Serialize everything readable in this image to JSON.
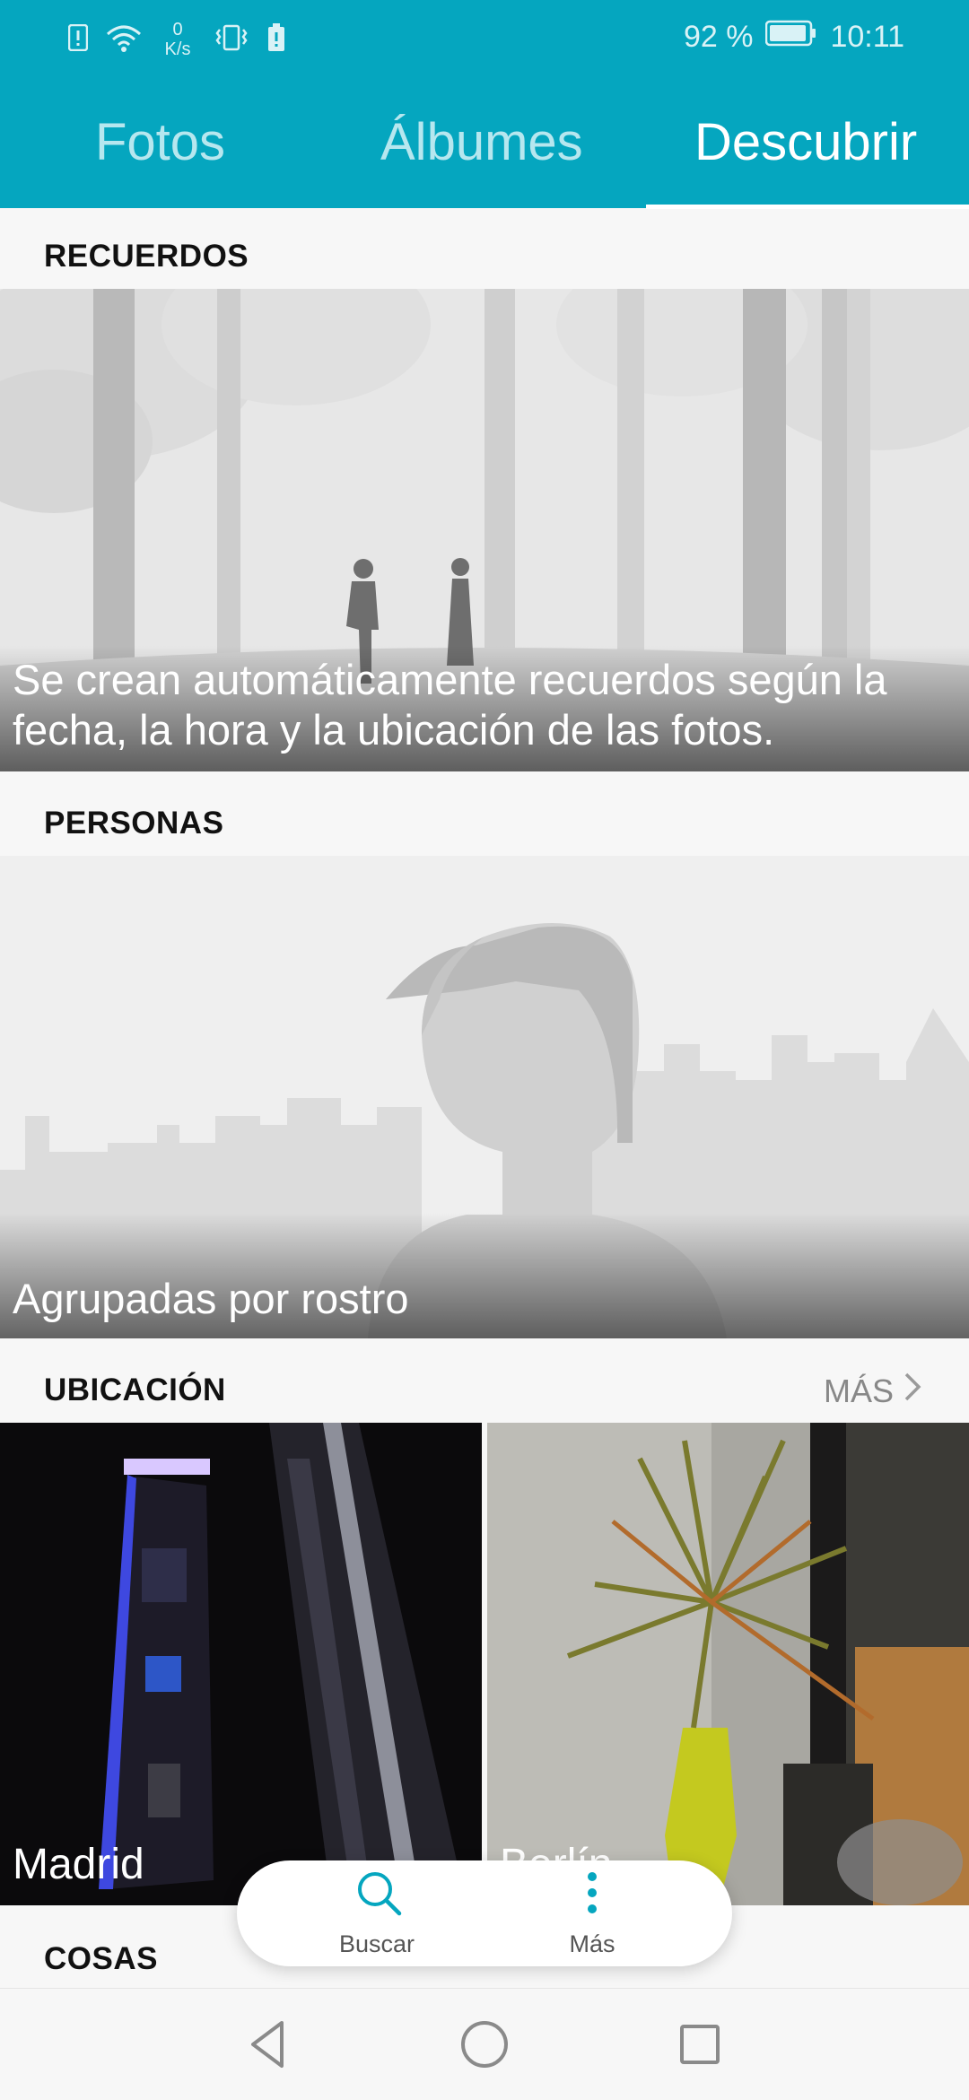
{
  "status_bar": {
    "net_speed_value": "0",
    "net_speed_unit": "K/s",
    "battery_percent": "92 %",
    "time": "10:11"
  },
  "tabs": [
    {
      "label": "Fotos",
      "active": false
    },
    {
      "label": "Álbumes",
      "active": false
    },
    {
      "label": "Descubrir",
      "active": true
    }
  ],
  "sections": {
    "memories": {
      "title": "RECUERDOS",
      "caption": "Se crean automáticamente recuerdos según la fecha, la hora y la ubicación de las fotos."
    },
    "people": {
      "title": "PERSONAS",
      "caption": "Agrupadas por rostro"
    },
    "location": {
      "title": "UBICACIÓN",
      "more_label": "MÁS",
      "places": [
        {
          "label": "Madrid"
        },
        {
          "label": "Berlín"
        }
      ]
    },
    "things": {
      "title": "COSAS"
    }
  },
  "floating_bar": {
    "search_label": "Buscar",
    "more_label": "Más"
  },
  "colors": {
    "accent": "#05a6bf",
    "background": "#f7f7f7"
  },
  "icons": [
    "alert-icon",
    "wifi-icon",
    "vibrate-icon",
    "battery-saver-icon",
    "battery-icon",
    "search-icon",
    "more-vertical-icon",
    "chevron-right-icon",
    "back-icon",
    "home-icon",
    "recents-icon"
  ]
}
